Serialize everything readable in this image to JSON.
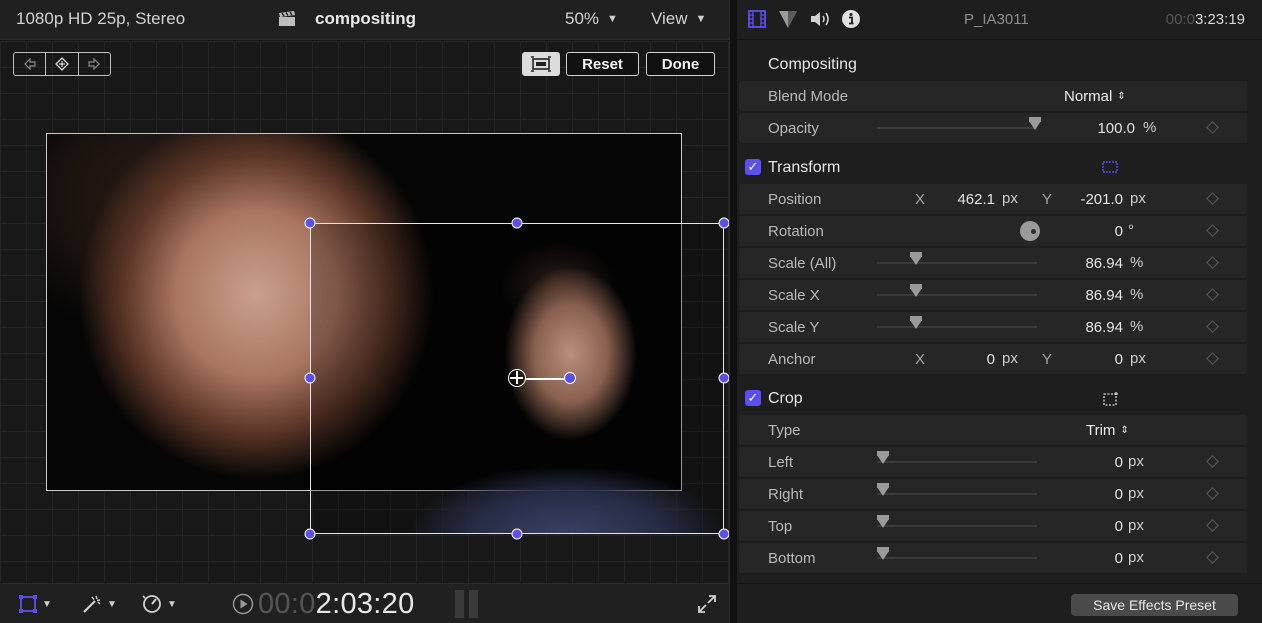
{
  "viewer": {
    "format": "1080p HD 25p, Stereo",
    "project": "compositing",
    "zoom": "50%",
    "view_menu": "View",
    "reset_label": "Reset",
    "done_label": "Done",
    "timecode_dim": "00:0",
    "timecode": "2:03:20",
    "caret": "⌄"
  },
  "inspector": {
    "clip_name": "P_IA3011",
    "duration_dim": "00:0",
    "duration": "3:23:19",
    "compositing": {
      "title": "Compositing",
      "blend_mode_label": "Blend Mode",
      "blend_mode_value": "Normal",
      "opacity_label": "Opacity",
      "opacity_value": "100.0",
      "opacity_unit": "%",
      "opacity_level": 1.0
    },
    "transform": {
      "title": "Transform",
      "position_label": "Position",
      "x_axis": "X",
      "y_axis": "Y",
      "position_x": "462.1",
      "position_y": "-201.0",
      "px": "px",
      "rotation_label": "Rotation",
      "rotation_value": "0",
      "rotation_unit": "°",
      "scale_all_label": "Scale (All)",
      "scale_all_value": "86.94",
      "scale_x_label": "Scale X",
      "scale_x_value": "86.94",
      "scale_y_label": "Scale Y",
      "scale_y_value": "86.94",
      "percent": "%",
      "anchor_label": "Anchor",
      "anchor_x": "0",
      "anchor_y": "0"
    },
    "crop": {
      "title": "Crop",
      "type_label": "Type",
      "type_value": "Trim",
      "left_label": "Left",
      "left_value": "0",
      "right_label": "Right",
      "right_value": "0",
      "top_label": "Top",
      "top_value": "0",
      "bottom_label": "Bottom",
      "bottom_value": "0",
      "px": "px"
    },
    "save_preset_label": "Save Effects Preset"
  },
  "colors": {
    "accent": "#5b4ff0",
    "background": "#1e1e1e"
  }
}
